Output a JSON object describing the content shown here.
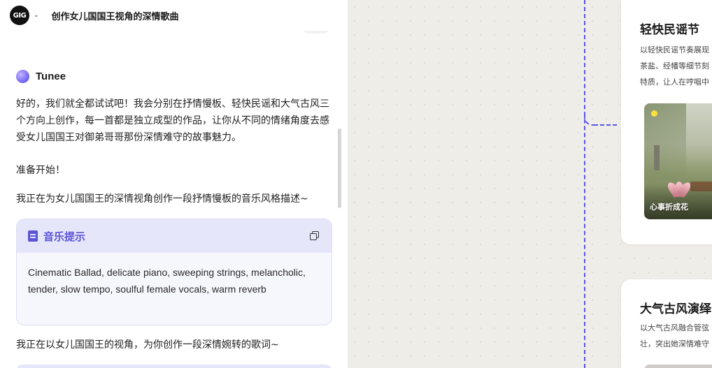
{
  "header": {
    "logo_text": "GIG",
    "title": "创作女儿国国王视角的深情歌曲"
  },
  "chat": {
    "agent_name": "Tunee",
    "message_intro": "好的，我们就全都试试吧！我会分别在抒情慢板、轻快民谣和大气古风三个方向上创作，每一首都是独立成型的作品，让你从不同的情绪角度去感受女儿国国王对御弟哥哥那份深情难守的故事魅力。",
    "message_start": "准备开始！",
    "status_style": "我正在为女儿国国王的深情视角创作一段抒情慢板的音乐风格描述~",
    "prompt_card": {
      "title": "音乐提示",
      "body": "Cinematic Ballad, delicate piano, sweeping strings, melancholic, tender, slow tempo, soulful female vocals, warm reverb"
    },
    "status_lyrics": "我正在以女儿国国王的视角，为你创作一段深情婉转的歌词~"
  },
  "canvas": {
    "card1": {
      "title": "轻快民谣节",
      "desc_lines": [
        "以轻快民谣节奏展现",
        "茶盐、经幡等细节刻",
        "特质，让人在哼唱中"
      ],
      "song_title": "心事折成花"
    },
    "card2": {
      "title": "大气古风演绎",
      "desc_lines": [
        "以大气古风融合管弦",
        "壮，突出她深情难守"
      ]
    }
  },
  "colors": {
    "accent": "#5b54d6",
    "connector": "#5b54e6",
    "canvas_bg": "#efede8"
  }
}
